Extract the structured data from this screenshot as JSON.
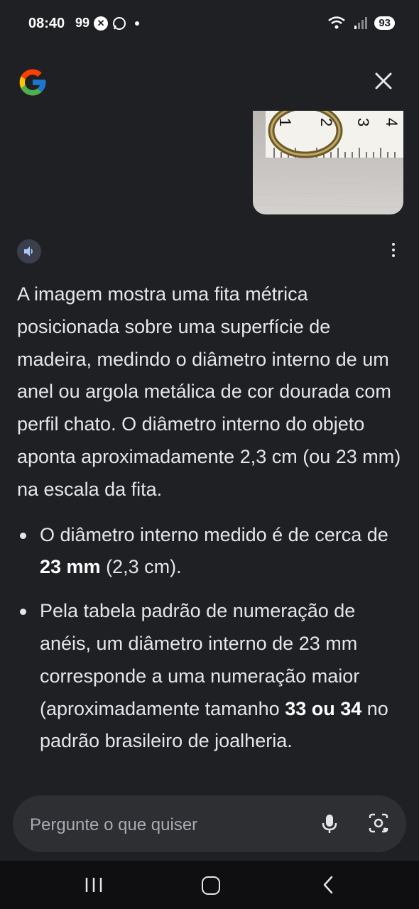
{
  "status_bar": {
    "time": "08:40",
    "notif_count": "99",
    "battery": "93"
  },
  "header": {
    "logo_icon": "google-g-icon",
    "close_icon": "close-icon"
  },
  "thumbnail": {
    "ruler_numbers": [
      "1",
      "2",
      "3",
      "4"
    ]
  },
  "answer": {
    "paragraph": "A imagem mostra uma fita métrica posicionada sobre uma superfície de madeira, medindo o diâmetro interno de um anel ou argola metálica de cor dourada com perfil chato. O diâmetro interno do objeto aponta aproximadamente 2,3 cm (ou 23 mm) na escala da fita.",
    "bullets": [
      {
        "pre": "O diâmetro interno medido é de cerca de ",
        "bold": "23 mm",
        "post": " (2,3 cm)."
      },
      {
        "pre": "Pela tabela padrão de numeração de anéis, um diâmetro interno de 23 mm corresponde a uma numeração maior (aproximadamente tamanho ",
        "bold": "33 ou 34",
        "post": " no padrão brasileiro de joalheria."
      }
    ]
  },
  "input": {
    "placeholder": "Pergunte o que quiser"
  },
  "colors": {
    "background": "#1f2023",
    "input_bg": "#2d2f33",
    "nav_bg": "#0f0f11"
  }
}
